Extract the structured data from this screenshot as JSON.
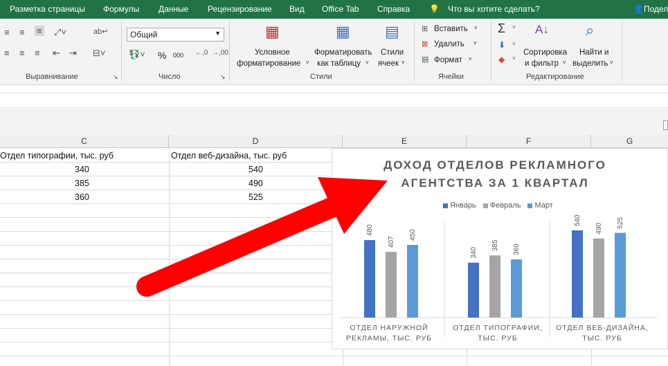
{
  "menu": {
    "items": [
      "Разметка страницы",
      "Формулы",
      "Данные",
      "Рецензирование",
      "Вид",
      "Office Tab",
      "Справка"
    ],
    "tell_me": "Что вы хотите сделать?",
    "share": "Подел"
  },
  "ribbon": {
    "alignment_label": "Выравнивание",
    "number_label": "Число",
    "number_format": "Общий",
    "styles_label": "Стили",
    "cells_label": "Ячейки",
    "editing_label": "Редактирование",
    "cond_format_1": "Условное",
    "cond_format_2": "форматирование",
    "format_table_1": "Форматировать",
    "format_table_2": "как таблицу",
    "cell_styles_1": "Стили",
    "cell_styles_2": "ячеек",
    "insert": "Вставить",
    "delete": "Удалить",
    "format": "Формат",
    "sort_1": "Сортировка",
    "sort_2": "и фильтр",
    "find_1": "Найти и",
    "find_2": "выделить",
    "percent": "%",
    "thousands": "000",
    "inc_decimal": ",0\n,00",
    "dec_decimal": ",00\n,0"
  },
  "columns": [
    "C",
    "D",
    "E",
    "F",
    "G"
  ],
  "sheet": {
    "header_c": "Отдел типографии, тыс. руб",
    "header_d": "Отдел веб-дизайна, тыс. руб",
    "c_values": [
      "340",
      "385",
      "360"
    ],
    "d_values": [
      "540",
      "490",
      "525"
    ]
  },
  "chart_data": {
    "type": "bar",
    "title_line1": "ДОХОД ОТДЕЛОВ РЕКЛАМНОГО",
    "title_line2": "АГЕНТСТВА ЗА 1 КВАРТАЛ",
    "categories": [
      "ОТДЕЛ НАРУЖНОЙ РЕКЛАМЫ, ТЫС. РУБ",
      "ОТДЕЛ ТИПОГРАФИИ, ТЫС. РУБ",
      "ОТДЕЛ ВЕБ-ДИЗАЙНА, ТЫС. РУБ"
    ],
    "category_lines": [
      [
        "ОТДЕЛ НАРУЖНОЙ",
        "РЕКЛАМЫ, ТЫС. РУБ"
      ],
      [
        "ОТДЕЛ ТИПОГРАФИИ,",
        "ТЫС. РУБ"
      ],
      [
        "ОТДЕЛ ВЕБ-ДИЗАЙНА,",
        "ТЫС. РУБ"
      ]
    ],
    "series": [
      {
        "name": "Январь",
        "color": "#4472c4",
        "values": [
          480,
          340,
          540
        ]
      },
      {
        "name": "Февраль",
        "color": "#a5a5a5",
        "values": [
          407,
          385,
          490
        ]
      },
      {
        "name": "Март",
        "color": "#5b9bd5",
        "values": [
          450,
          360,
          525
        ]
      }
    ],
    "ylim": [
      0,
      600
    ],
    "legend_position": "top"
  },
  "annotation": {
    "arrow_color": "#ff0000"
  }
}
